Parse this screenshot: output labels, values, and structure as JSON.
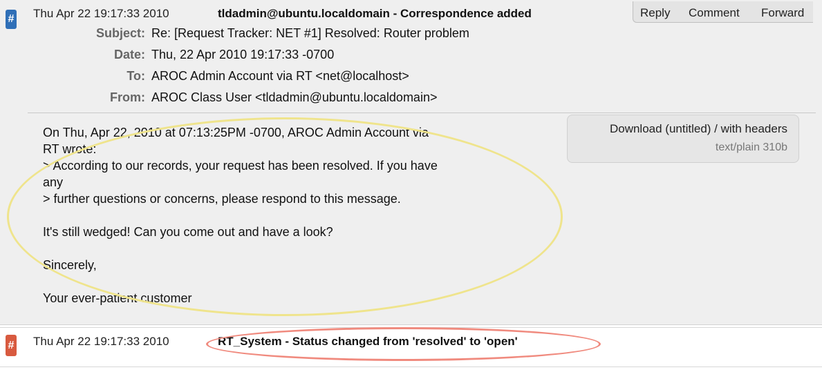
{
  "transaction1": {
    "date": "Thu Apr 22 19:17:33 2010",
    "description": "tldadmin@ubuntu.localdomain - Correspondence added",
    "tag_icon": "#",
    "actions": {
      "reply": "Reply",
      "comment": "Comment",
      "forward": "Forward"
    },
    "headers": {
      "subject_label": "Subject:",
      "subject": "Re: [Request Tracker: NET #1] Resolved: Router problem",
      "date_label": "Date:",
      "date": "Thu, 22 Apr 2010 19:17:33 -0700",
      "to_label": "To:",
      "to": "AROC Admin Account via RT <net@localhost>",
      "from_label": "From:",
      "from": "AROC Class User <tldadmin@ubuntu.localdomain>"
    },
    "body_lines": [
      "On Thu, Apr 22, 2010 at 07:13:25PM -0700, AROC Admin Account via",
      "RT wrote:",
      "> According to our records, your request has been resolved. If you have",
      "any",
      "> further questions or concerns, please respond to this message.",
      "It's still wedged! Can you come out and have a look?",
      "Sincerely,",
      "Your ever-patient customer"
    ],
    "attachment": {
      "link": "Download (untitled) / with headers",
      "meta": "text/plain 310b"
    }
  },
  "transaction2": {
    "date": "Thu Apr 22 19:17:33 2010",
    "description": "RT_System - Status changed from 'resolved' to 'open'",
    "tag_icon": "#"
  },
  "colors": {
    "correspondence_tag": "#2f6fb7",
    "status_tag": "#d85a3f",
    "highlight_yellow": "#efe48c",
    "highlight_red": "#f08a7e"
  }
}
